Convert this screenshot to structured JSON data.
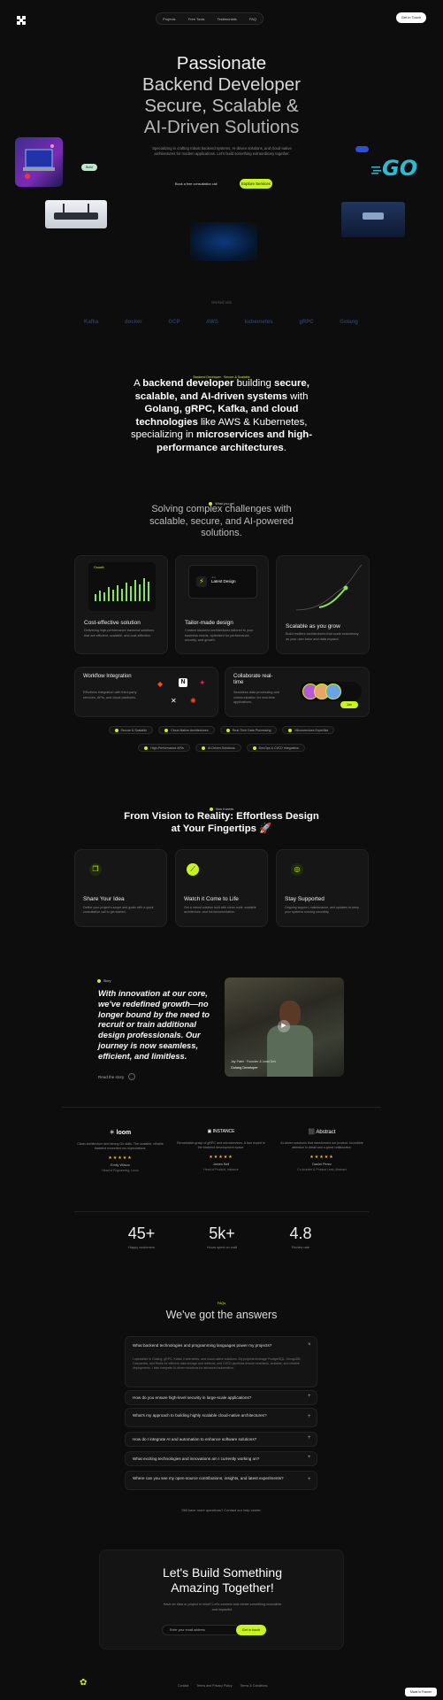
{
  "header": {
    "brand": "",
    "nav": [
      "Projects",
      "Free Tools",
      "Testimonials",
      "FAQ"
    ],
    "cta": "Get in Touch"
  },
  "hero": {
    "title": [
      "Passionate",
      "Backend Developer",
      "Secure, Scalable &",
      "AI-Driven Solutions"
    ],
    "subtitle": "Specializing in crafting robust backend systems, AI-driven solutions, and cloud-native architectures for modern applications. Let's build something extraordinary together.",
    "secondary_link": "Book a free consultation call",
    "primary_button": "Explore Services",
    "go_label": "GO",
    "chip": "Build"
  },
  "trusted": {
    "label": "Worked with",
    "logos": [
      "Kafka",
      "docker",
      "GCP",
      "AWS",
      "kubernetes",
      "gRPC",
      "Golang"
    ]
  },
  "about": {
    "badge": "Backend Developer · Secure & Scalable",
    "statement": [
      {
        "t": "A ",
        "b": false
      },
      {
        "t": "backend developer",
        "b": true
      },
      {
        "t": " building ",
        "b": false
      },
      {
        "t": "secure, scalable, and AI-driven systems",
        "b": true
      },
      {
        "t": " with ",
        "b": false
      },
      {
        "t": "Golang, gRPC, Kafka, and cloud technologies",
        "b": true
      },
      {
        "t": " like AWS & Kubernetes, specializing in ",
        "b": false
      },
      {
        "t": "microservices and high-performance architectures",
        "b": true
      },
      {
        "t": ".",
        "b": false
      }
    ]
  },
  "features": {
    "badge": "What you get",
    "heading": "Solving complex challenges with scalable, secure, and AI-powered solutions.",
    "cards": [
      {
        "title": "Cost-effective solution",
        "desc": "Delivering high-performance backend solutions that are efficient, scalable, and cost-effective.",
        "chart_label": "Growth"
      },
      {
        "title": "Tailor-made design",
        "desc": "Custom backend architectures tailored to your business needs, optimized for performance, security, and growth.",
        "widget_title": "Latest Design",
        "widget_sub": "Jira"
      },
      {
        "title": "Scalable as you grow",
        "desc": "Build resilient architectures that scale seamlessly as your user base and data expand."
      }
    ],
    "workflow": {
      "title": "Workflow Integration",
      "desc": "Effortless integration with third-party services, APIs, and cloud platforms."
    },
    "collab": {
      "title": "Collaborate real-time",
      "desc": "Seamless data processing and communication for real-time applications.",
      "button": "Join"
    },
    "tags_row1": [
      "Secure & Scalable",
      "Cloud-Native Architectures",
      "Real-Time Data Processing",
      "Microservices Expertise"
    ],
    "tags_row2": [
      "High-Performance APIs",
      "AI-Driven Solutions",
      "DevOps & CI/CD Integration"
    ]
  },
  "process": {
    "badge": "How it works",
    "heading_a": "From Vision to Reality: Effortless Design",
    "heading_b": "at Your Fingertips 🚀",
    "steps": [
      {
        "title": "Share Your Idea",
        "desc": "Define your project's scope and goals with a quick consultation call to get started."
      },
      {
        "title": "Watch it Come to Life",
        "desc": "Get a robust solution built with clean code, scalable architecture, and full documentation."
      },
      {
        "title": "Stay Supported",
        "desc": "Ongoing support, maintenance, and updates to keep your systems running smoothly."
      }
    ]
  },
  "story": {
    "badge": "Story",
    "quote": "With innovation at our core, we've redefined growth—no longer bound by the need to recruit or train additional design professionals. Our journey is now seamless, efficient, and limitless.",
    "link": "Read the story",
    "video_caption_a": "Jay Patel · Founder & Lead Dev",
    "video_caption_b": "Golang Developer"
  },
  "testimonials": [
    {
      "company": "loom",
      "quote": "Clean architecture and strong Go skills. The scalable, reliable backend exceeded our expectations.",
      "name": "Emily Wilson",
      "role": "Head of Engineering, Loom"
    },
    {
      "company": "INSTANCE",
      "quote": "Remarkable grasp of gRPC and microservices. A true expert in the backend development space.",
      "name": "James Bell",
      "role": "Head of Product, Instance"
    },
    {
      "company": "Abstract",
      "quote": "AI-driven solutions that transformed our product. Incredible attention to detail and a great collaborator.",
      "name": "Daniel Perez",
      "role": "Co-founder & Product Lead, Abstract"
    }
  ],
  "stats": [
    {
      "value": "45+",
      "label": "Happy customers"
    },
    {
      "value": "5k+",
      "label": "Hours spent on craft"
    },
    {
      "value": "4.8",
      "label": "Review rate"
    }
  ],
  "faq": {
    "badge": "FAQs",
    "heading": "We've got the answers",
    "items": [
      {
        "q": "What backend technologies and programming languages power my projects?",
        "a": "I specialize in Golang, gRPC, Kafka, Kubernetes, and cloud-native solutions. My projects leverage PostgreSQL, MongoDB, Cassandra, and Redis for efficient data storage and retrieval, and CI/CD pipelines ensure seamless, scalable, and reliable deployments. I also integrate AI-driven solutions for advanced automation.",
        "open": true
      },
      {
        "q": "How do you ensure high-level security in large-scale applications?",
        "open": false
      },
      {
        "q": "What's my approach to building highly scalable cloud-native architectures?",
        "open": false
      },
      {
        "q": "How do I integrate AI and automation to enhance software solutions?",
        "open": false
      },
      {
        "q": "What exciting technologies and innovations am I currently working on?",
        "open": false
      },
      {
        "q": "Where can you see my open-source contributions, insights, and latest experiments?",
        "open": false
      }
    ],
    "footer_text": "Still have more questions? Contact our help center."
  },
  "cta": {
    "heading_a": "Let's Build Something",
    "heading_b": "Amazing Together!",
    "desc": "Have an idea or project in mind? Let's connect and create something innovative and impactful.",
    "input_placeholder": "Enter your email address",
    "button": "Get in touch"
  },
  "footer": {
    "links": [
      "Contact",
      "Terms and Privacy Policy",
      "Terms & Conditions"
    ],
    "badge": "Made in Framer"
  },
  "colors": {
    "accent": "#c8f31d",
    "background": "#0d0d0d",
    "card": "#161616"
  }
}
